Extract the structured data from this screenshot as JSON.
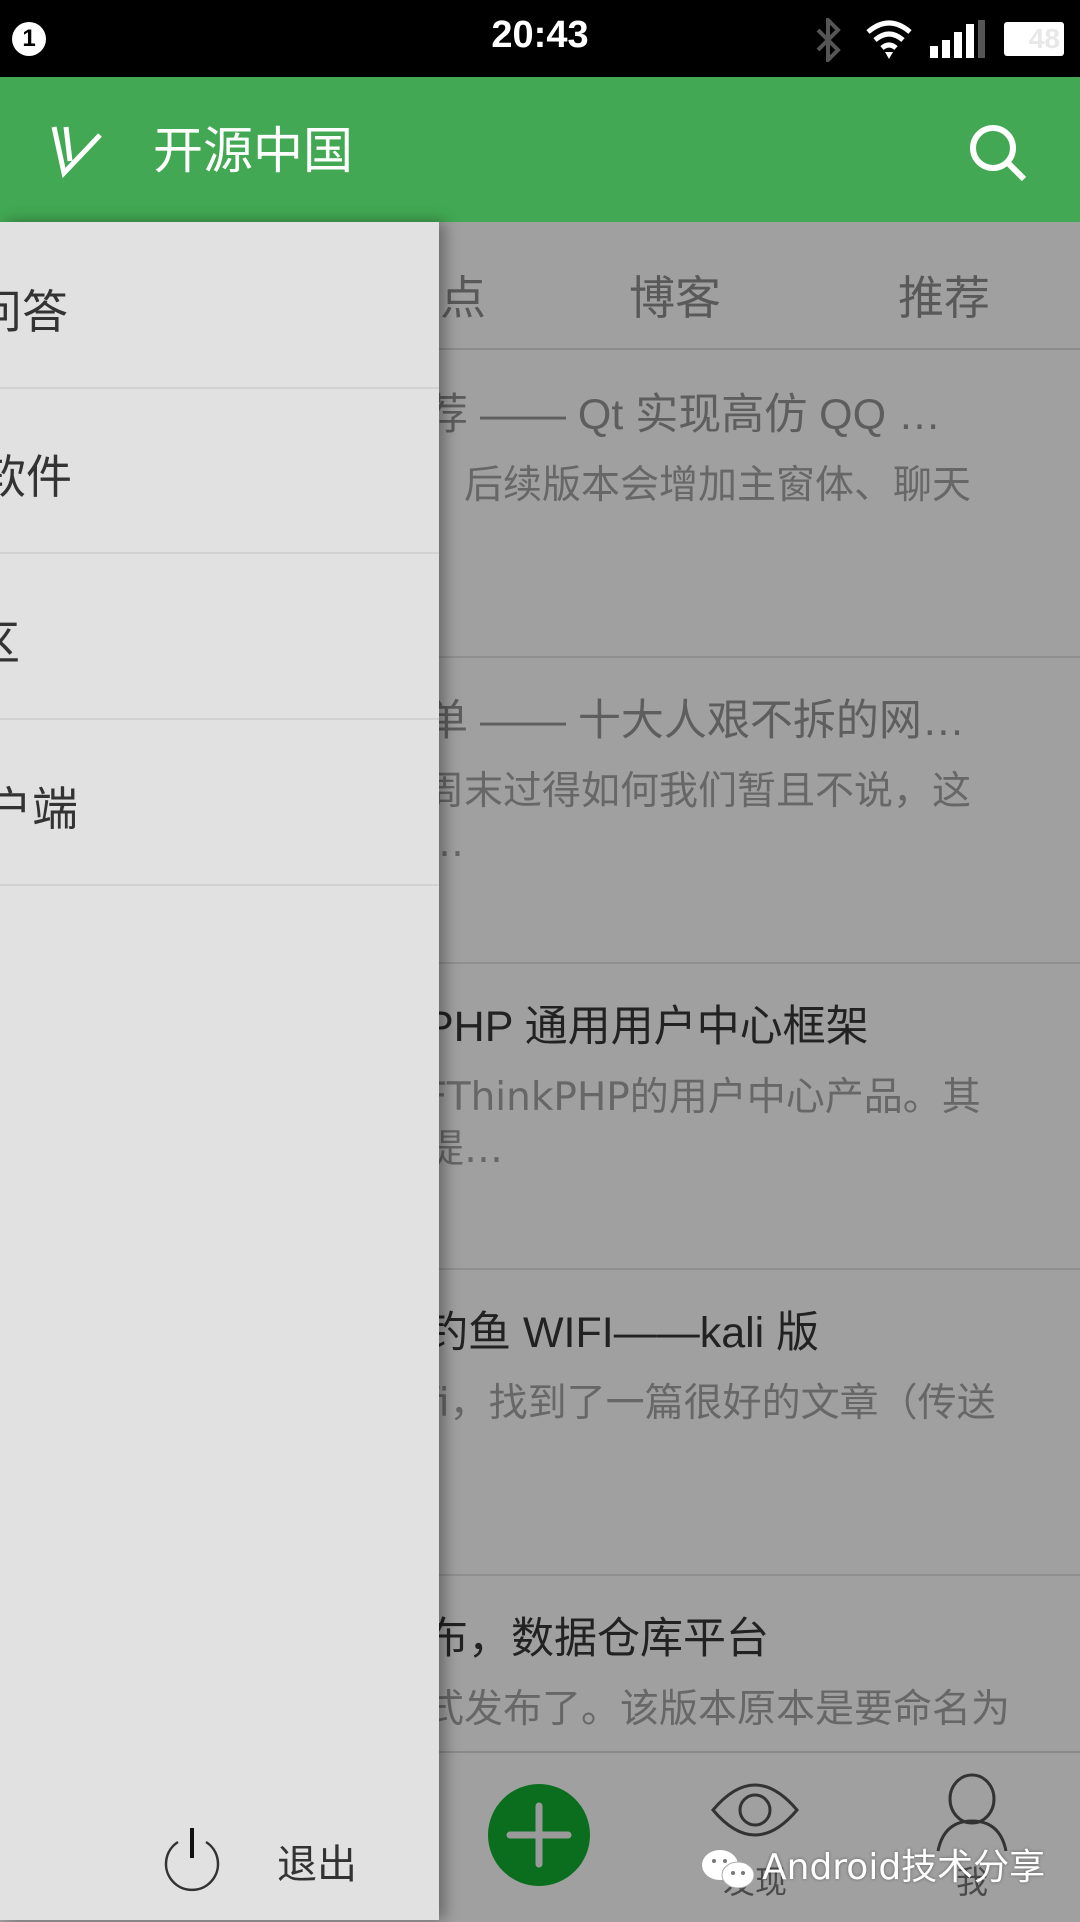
{
  "status_bar": {
    "notification_count": "1",
    "time": "20:43",
    "battery": "48"
  },
  "app_bar": {
    "title": "开源中国",
    "accent": "#42a853"
  },
  "tabs": [
    {
      "label": "热点"
    },
    {
      "label": "博客"
    },
    {
      "label": "推荐"
    }
  ],
  "articles": [
    {
      "title": "荐 —— Qt 实现高仿 QQ …",
      "desc": [
        "，后续版本会增加主窗体、聊天",
        "."
      ],
      "read": true
    },
    {
      "title": "单 —— 十大人艰不拆的网…",
      "desc": [
        "周末过得如何我们暂且不说，这",
        "…"
      ],
      "read": true
    },
    {
      "title": "PHP 通用用户中心框架",
      "desc": [
        "FThinkPHP的用户中心产品。其",
        "提…"
      ],
      "read": false
    },
    {
      "title": "钓鱼 WIFI——kali 版",
      "desc": [
        "fi，找到了一篇很好的文章（传送"
      ],
      "read": false
    },
    {
      "title": "布，数据仓库平台",
      "desc": [
        "式发布了。该版本原本是要命名为"
      ],
      "read": false
    }
  ],
  "drawer": {
    "items": [
      {
        "label": "问答"
      },
      {
        "label": "软件"
      },
      {
        "label": "区"
      },
      {
        "label": "户端"
      }
    ],
    "logout_label": "退出"
  },
  "bottom_nav": {
    "add_color": "#0a6e1e",
    "items": [
      {
        "label": "发现",
        "icon": "eye-icon"
      },
      {
        "label": "我",
        "icon": "person-icon"
      }
    ]
  },
  "watermark": "Android技术分享"
}
